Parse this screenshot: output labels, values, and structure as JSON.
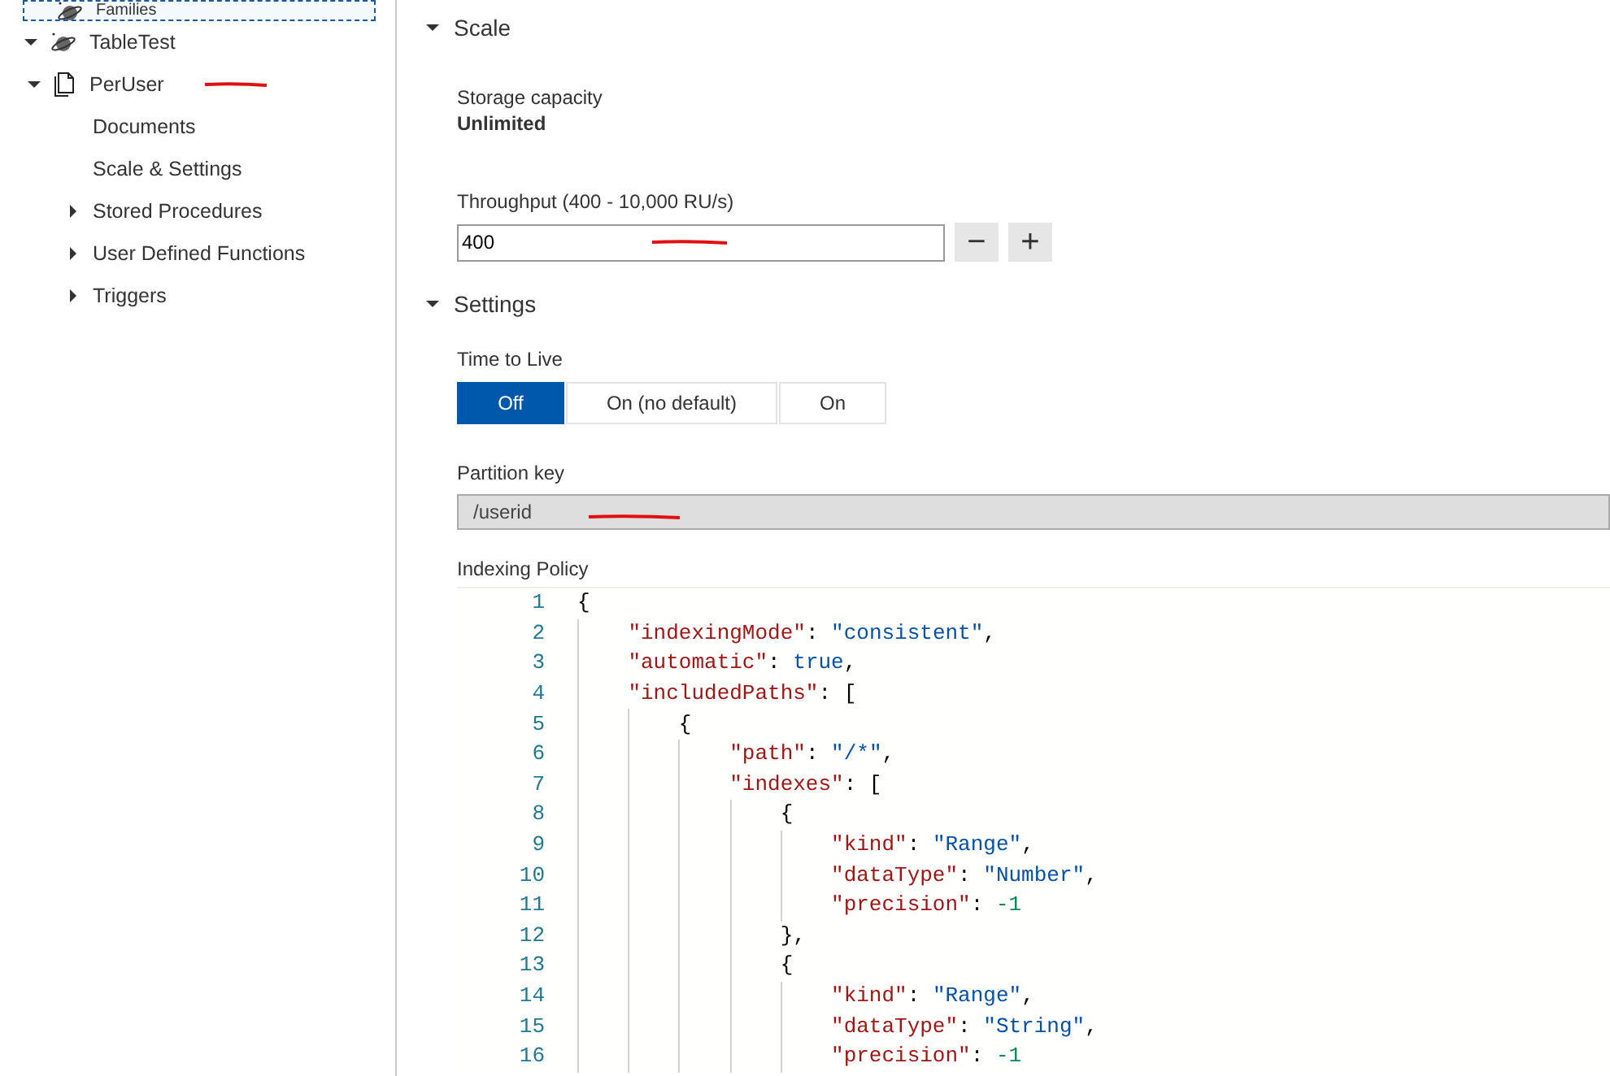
{
  "sidebar": {
    "tree": [
      {
        "label": "Families",
        "kind": "database",
        "focused": true
      },
      {
        "label": "TableTest",
        "kind": "database",
        "focused": false,
        "expanded": true,
        "children": [
          {
            "label": "PerUser",
            "kind": "collection",
            "focused": false,
            "expanded": true,
            "annotated": true,
            "children": [
              {
                "label": "Documents",
                "focused": false
              },
              {
                "label": "Scale & Settings",
                "focused": false
              },
              {
                "label": "Stored Procedures",
                "focused": false,
                "expanded": false
              },
              {
                "label": "User Defined Functions",
                "focused": false,
                "expanded": false
              },
              {
                "label": "Triggers",
                "focused": false,
                "expanded": false
              }
            ]
          }
        ]
      }
    ]
  },
  "scale": {
    "title": "Scale",
    "expanded": true,
    "storage_label": "Storage capacity",
    "storage_value": "Unlimited",
    "throughput_label": "Throughput (400 - 10,000 RU/s)",
    "throughput_value": "400",
    "throughput_annotated": true,
    "decrement": "−",
    "increment": "+"
  },
  "settings": {
    "title": "Settings",
    "expanded": true,
    "ttl_label": "Time to Live",
    "ttl_options": [
      {
        "label": "Off",
        "selected": true
      },
      {
        "label": "On (no default)",
        "selected": false
      },
      {
        "label": "On",
        "selected": false
      }
    ],
    "partition_label": "Partition key",
    "partition_value": "/userid",
    "partition_annotated": true,
    "indexing_label": "Indexing Policy"
  },
  "editor": {
    "lines": [
      {
        "number": "1",
        "tokens": [
          {
            "kind": "punct",
            "text": "{"
          }
        ]
      },
      {
        "number": "2",
        "tokens": [
          {
            "kind": "key",
            "text": "    \"indexingMode\""
          },
          {
            "kind": "punct",
            "text": ": "
          },
          {
            "kind": "string",
            "text": "\"consistent\""
          },
          {
            "kind": "punct",
            "text": ","
          }
        ]
      },
      {
        "number": "3",
        "tokens": [
          {
            "kind": "key",
            "text": "    \"automatic\""
          },
          {
            "kind": "punct",
            "text": ": "
          },
          {
            "kind": "string",
            "text": "true"
          },
          {
            "kind": "punct",
            "text": ","
          }
        ]
      },
      {
        "number": "4",
        "tokens": [
          {
            "kind": "key",
            "text": "    \"includedPaths\""
          },
          {
            "kind": "punct",
            "text": ": ["
          }
        ]
      },
      {
        "number": "5",
        "tokens": [
          {
            "kind": "punct",
            "text": "        {"
          }
        ]
      },
      {
        "number": "6",
        "tokens": [
          {
            "kind": "key",
            "text": "            \"path\""
          },
          {
            "kind": "punct",
            "text": ": "
          },
          {
            "kind": "string",
            "text": "\"/*\""
          },
          {
            "kind": "punct",
            "text": ","
          }
        ]
      },
      {
        "number": "7",
        "tokens": [
          {
            "kind": "key",
            "text": "            \"indexes\""
          },
          {
            "kind": "punct",
            "text": ": ["
          }
        ]
      },
      {
        "number": "8",
        "tokens": [
          {
            "kind": "punct",
            "text": "                {"
          }
        ]
      },
      {
        "number": "9",
        "tokens": [
          {
            "kind": "key",
            "text": "                    \"kind\""
          },
          {
            "kind": "punct",
            "text": ": "
          },
          {
            "kind": "string",
            "text": "\"Range\""
          },
          {
            "kind": "punct",
            "text": ","
          }
        ]
      },
      {
        "number": "10",
        "tokens": [
          {
            "kind": "key",
            "text": "                    \"dataType\""
          },
          {
            "kind": "punct",
            "text": ": "
          },
          {
            "kind": "string",
            "text": "\"Number\""
          },
          {
            "kind": "punct",
            "text": ","
          }
        ]
      },
      {
        "number": "11",
        "tokens": [
          {
            "kind": "key",
            "text": "                    \"precision\""
          },
          {
            "kind": "punct",
            "text": ": "
          },
          {
            "kind": "number",
            "text": "-1"
          }
        ]
      },
      {
        "number": "12",
        "tokens": [
          {
            "kind": "punct",
            "text": "                },"
          }
        ]
      },
      {
        "number": "13",
        "tokens": [
          {
            "kind": "punct",
            "text": "                {"
          }
        ]
      },
      {
        "number": "14",
        "tokens": [
          {
            "kind": "key",
            "text": "                    \"kind\""
          },
          {
            "kind": "punct",
            "text": ": "
          },
          {
            "kind": "string",
            "text": "\"Range\""
          },
          {
            "kind": "punct",
            "text": ","
          }
        ]
      },
      {
        "number": "15",
        "tokens": [
          {
            "kind": "key",
            "text": "                    \"dataType\""
          },
          {
            "kind": "punct",
            "text": ": "
          },
          {
            "kind": "string",
            "text": "\"String\""
          },
          {
            "kind": "punct",
            "text": ","
          }
        ]
      },
      {
        "number": "16",
        "tokens": [
          {
            "kind": "key",
            "text": "                    \"precision\""
          },
          {
            "kind": "punct",
            "text": ": "
          },
          {
            "kind": "number",
            "text": "-1"
          }
        ]
      }
    ]
  }
}
